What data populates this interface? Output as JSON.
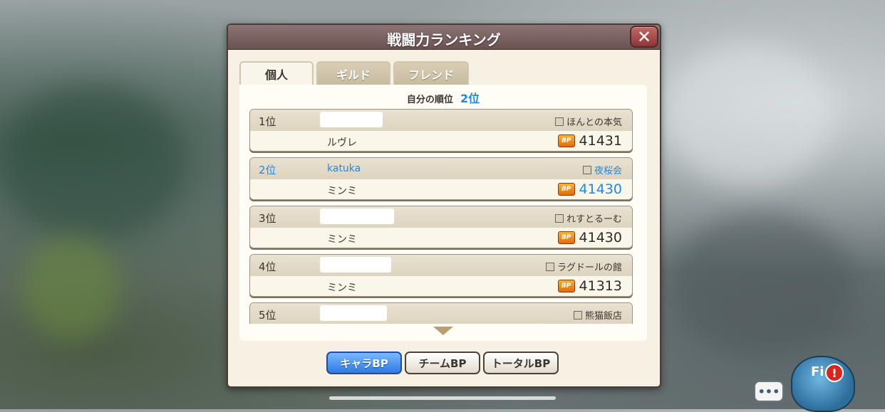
{
  "dialog": {
    "title": "戦闘力ランキング",
    "close_label": "✕"
  },
  "tabs": [
    {
      "label": "個人",
      "active": true
    },
    {
      "label": "ギルド",
      "active": false
    },
    {
      "label": "フレンド",
      "active": false
    }
  ],
  "my_rank": {
    "label": "自分の順位",
    "value": "2位"
  },
  "ranking": [
    {
      "rank": "1位",
      "player": "",
      "guild": "ほんとの本気",
      "character": "ルヴレ",
      "bp": "41431",
      "is_self": false
    },
    {
      "rank": "2位",
      "player": "katuka",
      "guild": "夜桜会",
      "character": "ミンミ",
      "bp": "41430",
      "is_self": true
    },
    {
      "rank": "3位",
      "player": "",
      "guild": "れすとるーむ",
      "character": "ミンミ",
      "bp": "41430",
      "is_self": false
    },
    {
      "rank": "4位",
      "player": "",
      "guild": "ラグドールの館",
      "character": "ミンミ",
      "bp": "41313",
      "is_self": false
    },
    {
      "rank": "5位",
      "player": "",
      "guild": "熊猫飯店",
      "character": "",
      "bp": "",
      "is_self": false
    }
  ],
  "bp_icon_text": "BP",
  "bottom_buttons": [
    {
      "label": "キャラBP",
      "active": true
    },
    {
      "label": "チームBP",
      "active": false
    },
    {
      "label": "トータルBP",
      "active": false
    }
  ],
  "overlay": {
    "chat_label": "•••",
    "mascot_text": "Fi",
    "alert_text": "!"
  },
  "colors": {
    "accent_blue": "#1e8ae0",
    "title_bar": "#7c6262",
    "bp_orange": "#e46a12"
  }
}
